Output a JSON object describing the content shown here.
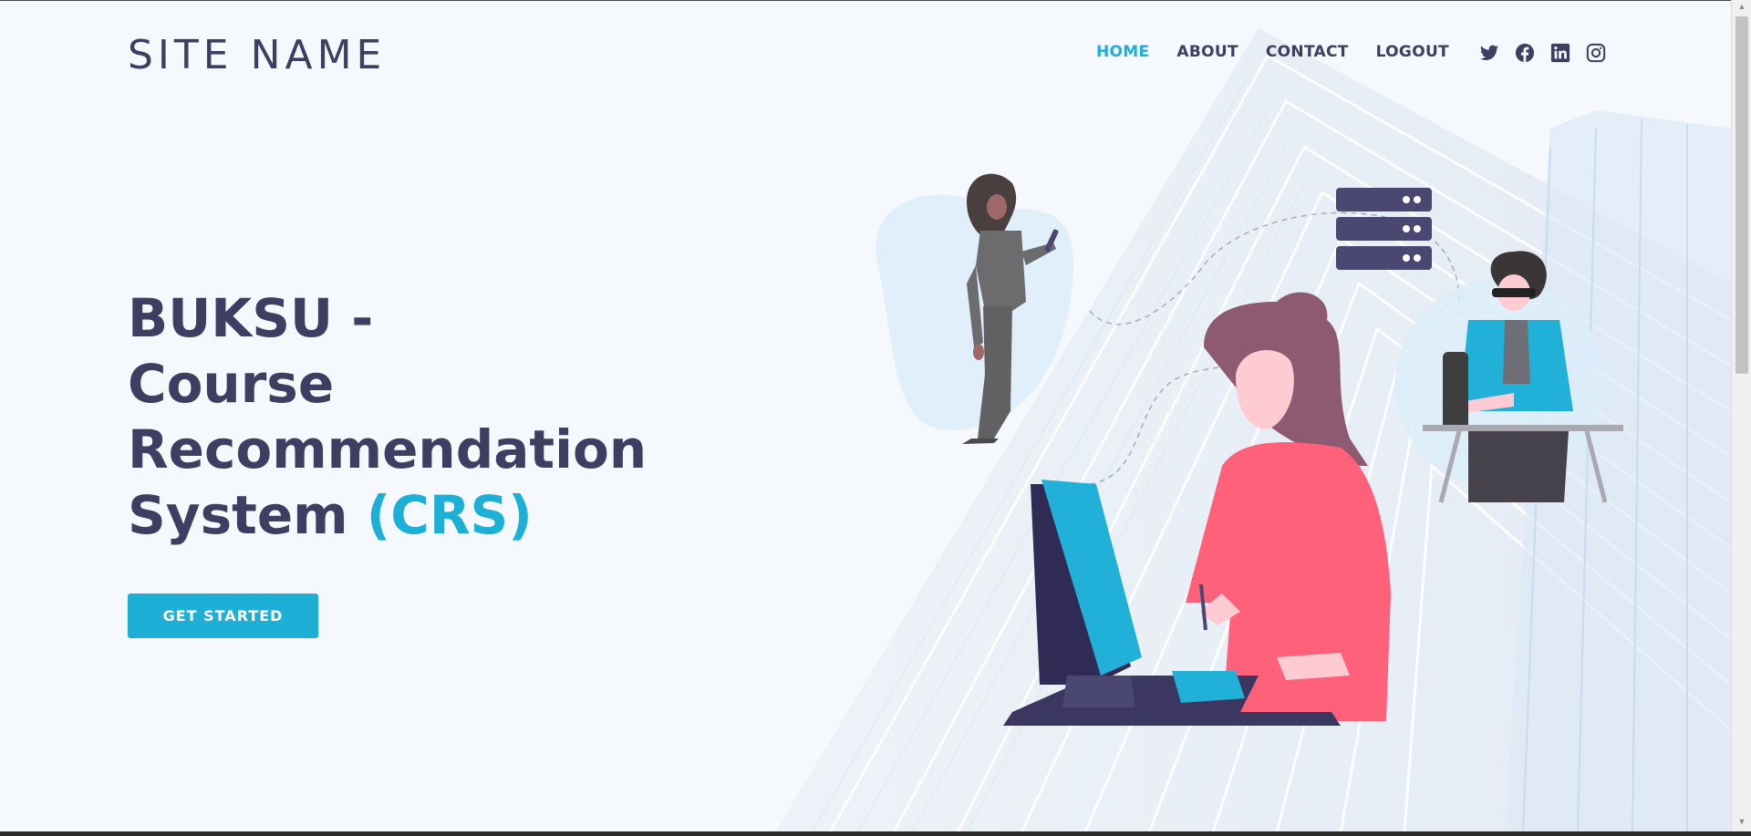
{
  "header": {
    "brand": "SITE NAME",
    "nav": [
      "HOME",
      "ABOUT",
      "CONTACT",
      "LOGOUT"
    ],
    "active_nav": "HOME",
    "social_icons": [
      "twitter-icon",
      "facebook-icon",
      "linkedin-icon",
      "instagram-icon"
    ]
  },
  "hero": {
    "title_line1": "BUKSU -",
    "title_line2": "Course",
    "title_line3": "Recommendation",
    "title_line4_main": "System ",
    "title_line4_accent": "(CRS)",
    "cta_label": "GET STARTED"
  },
  "colors": {
    "accent": "#1eafd6",
    "text_dark": "#3e3e62",
    "background": "#f5f8fd",
    "illustration_pink": "#fe6179",
    "illustration_purple": "#4b4773"
  }
}
